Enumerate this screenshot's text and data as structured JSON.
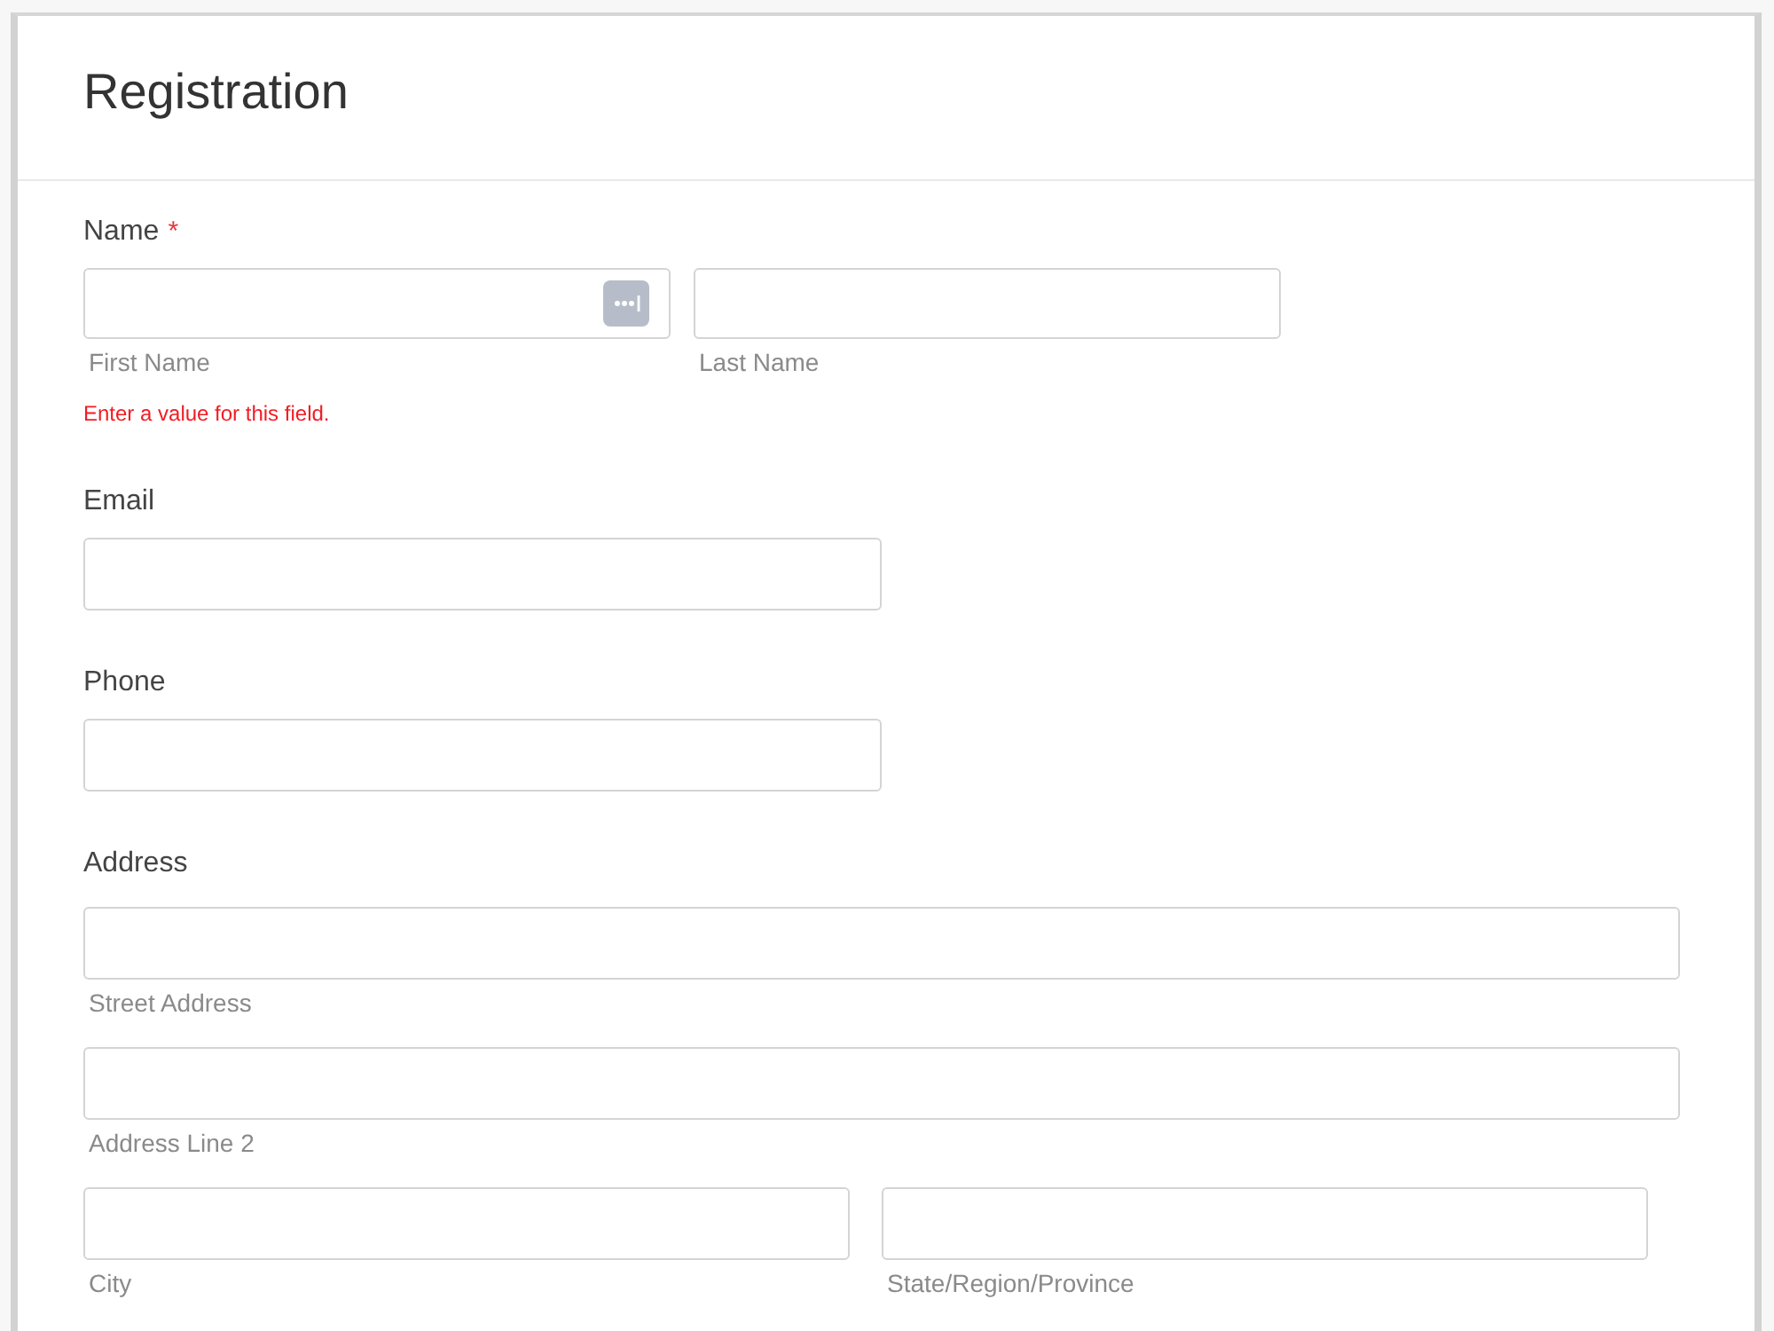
{
  "title": "Registration",
  "sections": [
    {
      "kind": "name",
      "label": "Name",
      "required_mark": "*",
      "rows": [
        [
          {
            "sublabel": "First Name",
            "icon": true
          },
          {
            "sublabel": "Last Name"
          }
        ]
      ],
      "error": "Enter a value for this field."
    },
    {
      "kind": "single",
      "label": "Email"
    },
    {
      "kind": "single",
      "label": "Phone"
    },
    {
      "kind": "address",
      "label": "Address",
      "rows": [
        [
          {
            "sublabel": "Street Address"
          }
        ],
        [
          {
            "sublabel": "Address Line 2"
          }
        ],
        [
          {
            "sublabel": "City"
          },
          {
            "sublabel": "State/Region/Province"
          }
        ]
      ]
    }
  ]
}
